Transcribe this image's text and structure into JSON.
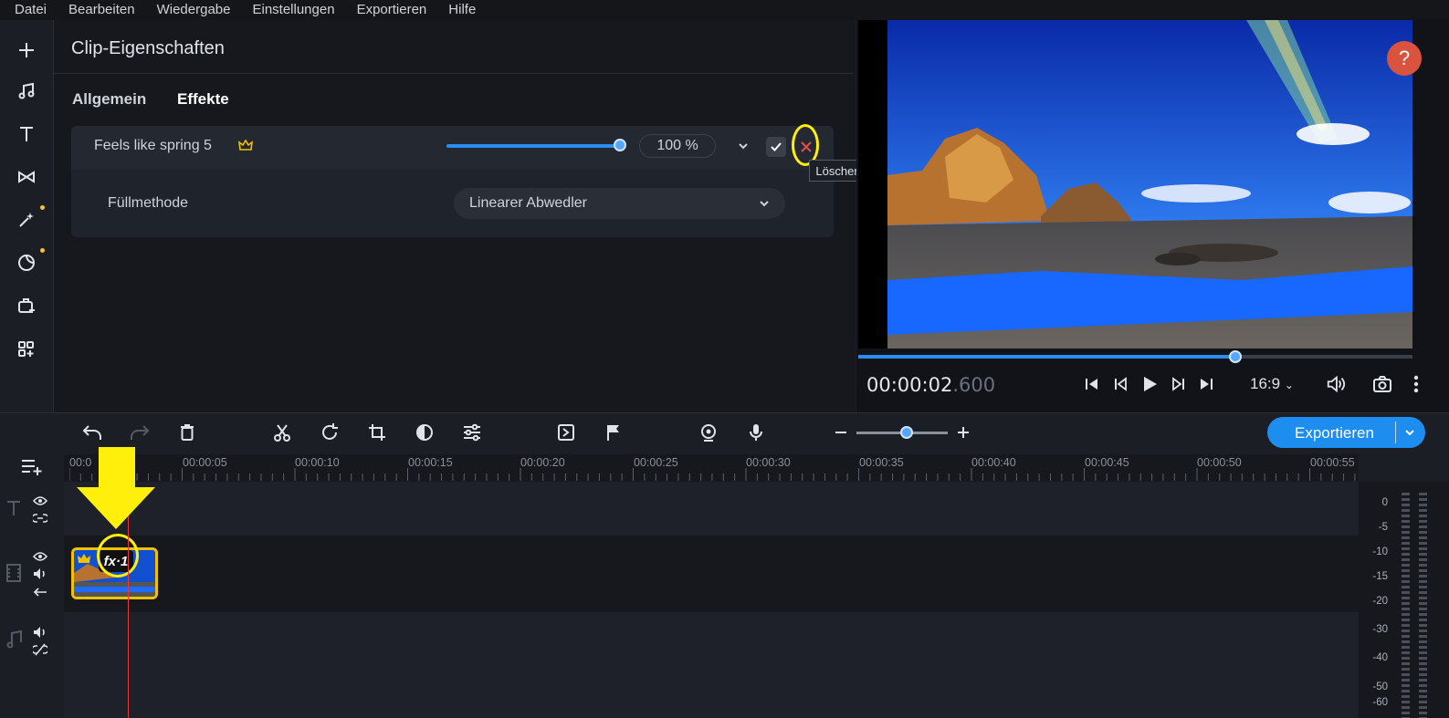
{
  "menu": [
    "Datei",
    "Bearbeiten",
    "Wiedergabe",
    "Einstellungen",
    "Exportieren",
    "Hilfe"
  ],
  "left_tools": [
    "add-icon",
    "music-icon",
    "text-icon",
    "transition-icon",
    "magic-icon",
    "sticker-icon",
    "briefcase-add-icon",
    "apps-add-icon"
  ],
  "props": {
    "title": "Clip-Eigenschaften",
    "tabs": [
      "Allgemein",
      "Effekte"
    ],
    "effect": {
      "name": "Feels like spring 5",
      "intensity_percent": 100,
      "intensity_label": "100 %",
      "delete_tooltip": "Löschen"
    },
    "fill": {
      "label": "Füllmethode",
      "value": "Linearer Abwedler"
    }
  },
  "preview": {
    "help": "?",
    "progress_fraction": 0.68,
    "timecode_main": "00:00:02",
    "timecode_ms": ".600",
    "ratio": "16:9"
  },
  "toolbar": {
    "export_label": "Exportieren",
    "zoom_fraction": 0.55
  },
  "ruler": [
    "00:0",
    "00:00:05",
    "00:00:10",
    "00:00:15",
    "00:00:20",
    "00:00:25",
    "00:00:30",
    "00:00:35",
    "00:00:40",
    "00:00:45",
    "00:00:50",
    "00:00:55"
  ],
  "clip": {
    "fx_label": "fx·1"
  },
  "meter_db": [
    "0",
    "-5",
    "-10",
    "-15",
    "-20",
    "-30",
    "-40",
    "-50",
    "-60"
  ],
  "colors": {
    "accent": "#1e8df0",
    "highlight": "#ffef0a",
    "clip_border": "#f2c200",
    "playhead": "#e23b3b"
  }
}
